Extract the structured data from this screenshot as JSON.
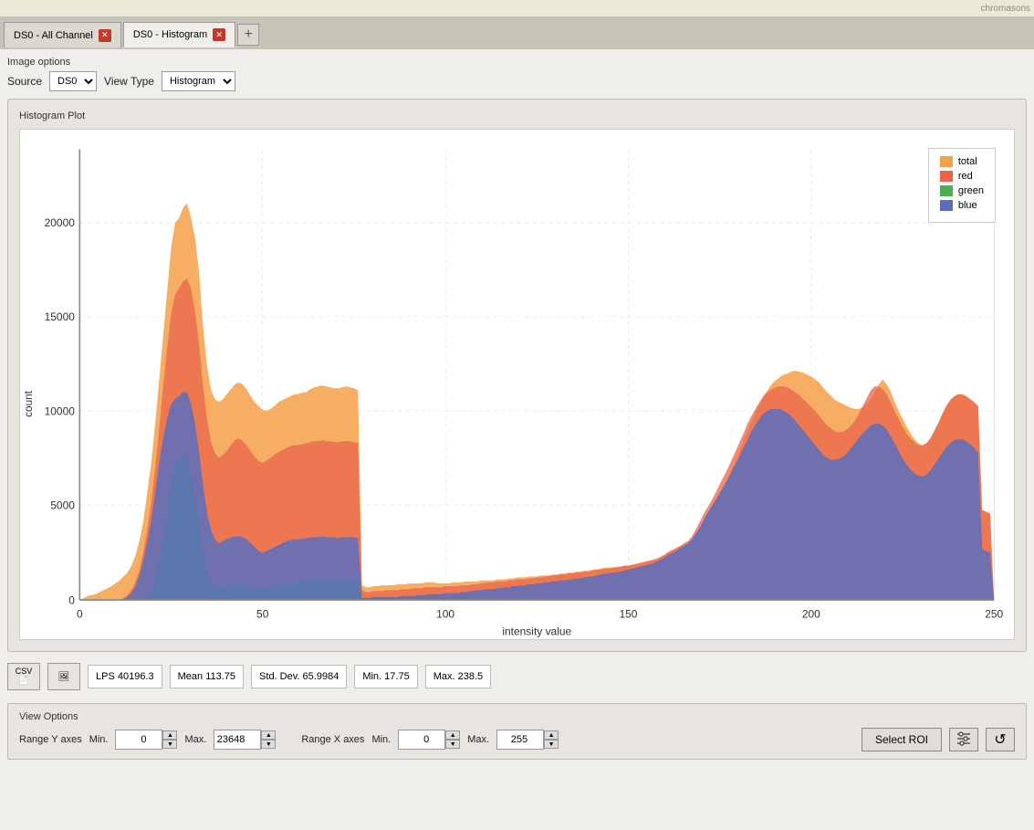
{
  "app": {
    "brand": "chromasons"
  },
  "tabs": [
    {
      "id": "tab-allchannel",
      "label": "DS0 - All Channel",
      "active": false,
      "closable": true
    },
    {
      "id": "tab-histogram",
      "label": "DS0 - Histogram",
      "active": true,
      "closable": true
    }
  ],
  "add_tab_label": "+",
  "image_options": {
    "title": "Image options",
    "source_label": "Source",
    "source_value": "DS0",
    "source_options": [
      "DS0"
    ],
    "view_type_label": "View Type",
    "view_type_value": "Histogram",
    "view_type_options": [
      "Histogram"
    ]
  },
  "chart": {
    "title": "Histogram Plot",
    "y_axis_label": "count",
    "x_axis_label": "intensity value",
    "y_ticks": [
      "0",
      "5000",
      "10000",
      "15000",
      "20000"
    ],
    "x_ticks": [
      "0",
      "50",
      "100",
      "150",
      "200",
      "250"
    ],
    "legend": [
      {
        "id": "total",
        "label": "total",
        "color": "#F5A04A"
      },
      {
        "id": "red",
        "label": "red",
        "color": "#E8644A"
      },
      {
        "id": "green",
        "label": "green",
        "color": "#4CAF50"
      },
      {
        "id": "blue",
        "label": "blue",
        "color": "#5B6EBE"
      }
    ]
  },
  "stats": {
    "lps_label": "LPS",
    "lps_value": "40196.3",
    "mean_label": "Mean",
    "mean_value": "113.75",
    "stddev_label": "Std. Dev.",
    "stddev_value": "65.9984",
    "min_label": "Min.",
    "min_value": "17.75",
    "max_label": "Max.",
    "max_value": "238.5"
  },
  "view_options": {
    "title": "View Options",
    "range_y_label": "Range Y axes",
    "min_label": "Min.",
    "y_min": "0",
    "max_label": "Max.",
    "y_max": "23648",
    "range_x_label": "Range X axes",
    "x_min": "0",
    "x_max": "255",
    "select_roi_label": "Select ROI",
    "reset_label": "↺"
  }
}
